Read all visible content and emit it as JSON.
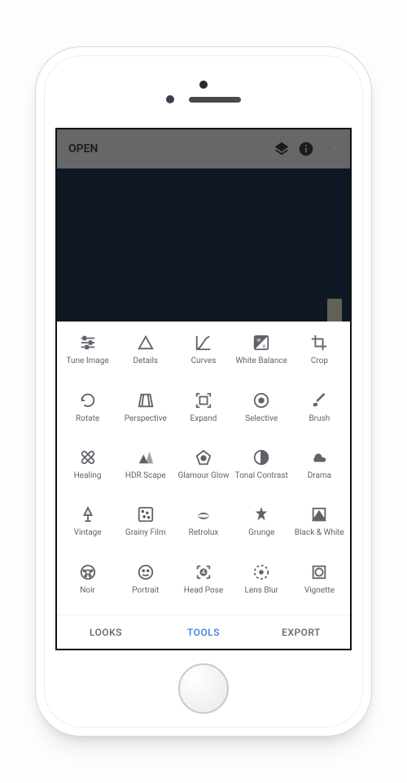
{
  "header": {
    "open_label": "OPEN"
  },
  "tools": [
    {
      "label": "Tune Image",
      "icon": "tune"
    },
    {
      "label": "Details",
      "icon": "details"
    },
    {
      "label": "Curves",
      "icon": "curves"
    },
    {
      "label": "White Balance",
      "icon": "whitebalance"
    },
    {
      "label": "Crop",
      "icon": "crop"
    },
    {
      "label": "Rotate",
      "icon": "rotate"
    },
    {
      "label": "Perspective",
      "icon": "perspective"
    },
    {
      "label": "Expand",
      "icon": "expand"
    },
    {
      "label": "Selective",
      "icon": "selective"
    },
    {
      "label": "Brush",
      "icon": "brush"
    },
    {
      "label": "Healing",
      "icon": "healing"
    },
    {
      "label": "HDR Scape",
      "icon": "hdr"
    },
    {
      "label": "Glamour Glow",
      "icon": "glow"
    },
    {
      "label": "Tonal Contrast",
      "icon": "tonal"
    },
    {
      "label": "Drama",
      "icon": "drama"
    },
    {
      "label": "Vintage",
      "icon": "vintage"
    },
    {
      "label": "Grainy Film",
      "icon": "grainy"
    },
    {
      "label": "Retrolux",
      "icon": "retrolux"
    },
    {
      "label": "Grunge",
      "icon": "grunge"
    },
    {
      "label": "Black & White",
      "icon": "bw"
    },
    {
      "label": "Noir",
      "icon": "noir"
    },
    {
      "label": "Portrait",
      "icon": "portrait"
    },
    {
      "label": "Head Pose",
      "icon": "headpose"
    },
    {
      "label": "Lens Blur",
      "icon": "lensblur"
    },
    {
      "label": "Vignette",
      "icon": "vignette"
    }
  ],
  "tabs": {
    "looks": "LOOKS",
    "tools": "TOOLS",
    "export": "EXPORT",
    "active": "tools"
  }
}
